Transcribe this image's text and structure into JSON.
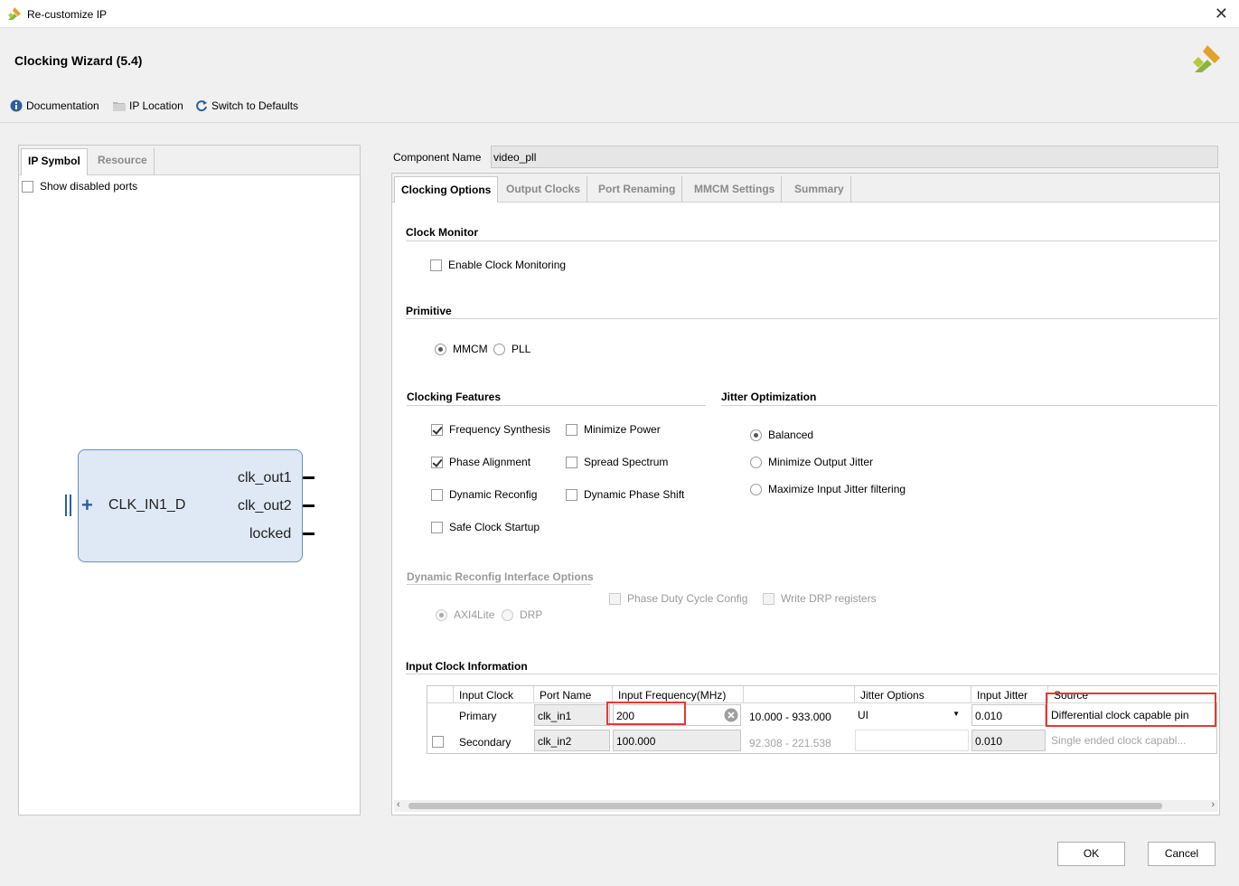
{
  "window": {
    "title": "Re-customize IP",
    "close_glyph": "✕"
  },
  "header": {
    "title": "Clocking Wizard (5.4)",
    "toolbar": [
      {
        "label": "Documentation",
        "icon": "info-icon"
      },
      {
        "label": "IP Location",
        "icon": "folder-icon"
      },
      {
        "label": "Switch to Defaults",
        "icon": "refresh-icon"
      }
    ]
  },
  "left_panel": {
    "tabs": [
      "IP Symbol",
      "Resource"
    ],
    "active_tab": "IP Symbol",
    "show_disabled_ports": "Show disabled ports",
    "symbol": {
      "input_port": "CLK_IN1_D",
      "outputs": [
        "clk_out1",
        "clk_out2",
        "locked"
      ]
    }
  },
  "component": {
    "label": "Component Name",
    "value": "video_pll"
  },
  "tabs": [
    "Clocking Options",
    "Output Clocks",
    "Port Renaming",
    "MMCM Settings",
    "Summary"
  ],
  "active_tab": "Clocking Options",
  "clock_monitor": {
    "title": "Clock Monitor",
    "enable_label": "Enable Clock Monitoring",
    "enabled": false
  },
  "primitive": {
    "title": "Primitive",
    "options": [
      "MMCM",
      "PLL"
    ],
    "selected": "MMCM"
  },
  "clocking_features": {
    "title": "Clocking Features",
    "items": [
      {
        "label": "Frequency Synthesis",
        "checked": true
      },
      {
        "label": "Minimize Power",
        "checked": false
      },
      {
        "label": "Phase Alignment",
        "checked": true
      },
      {
        "label": "Spread Spectrum",
        "checked": false
      },
      {
        "label": "Dynamic Reconfig",
        "checked": false
      },
      {
        "label": "Dynamic Phase Shift",
        "checked": false
      },
      {
        "label": "Safe Clock Startup",
        "checked": false
      }
    ]
  },
  "jitter_optimization": {
    "title": "Jitter Optimization",
    "options": [
      "Balanced",
      "Minimize Output Jitter",
      "Maximize Input Jitter filtering"
    ],
    "selected": "Balanced"
  },
  "drp_options": {
    "title": "Dynamic Reconfig Interface Options",
    "checkboxes": [
      "Phase Duty Cycle Config",
      "Write DRP registers"
    ],
    "radios": [
      "AXI4Lite",
      "DRP"
    ],
    "selected": "AXI4Lite"
  },
  "input_clock_info": {
    "title": "Input Clock Information",
    "columns": [
      "Input Clock",
      "Port Name",
      "Input Frequency(MHz)",
      "",
      "Jitter Options",
      "Input Jitter",
      "Source"
    ],
    "rows": [
      {
        "name": "Primary",
        "port": "clk_in1",
        "freq": "200",
        "range": "10.000 - 933.000",
        "jitter_option": "UI",
        "input_jitter": "0.010",
        "source": "Differential clock capable pin"
      },
      {
        "name": "Secondary",
        "port": "clk_in2",
        "freq": "100.000",
        "range": "92.308 - 221.538",
        "jitter_option": "",
        "input_jitter": "0.010",
        "source": "Single ended clock capabl..."
      }
    ]
  },
  "buttons": {
    "ok": "OK",
    "cancel": "Cancel"
  },
  "colors": {
    "highlight": "#e53935",
    "symbol_fill": "#dfe9f5",
    "symbol_border": "#6a8fbf",
    "brand": "#8cb43c"
  }
}
